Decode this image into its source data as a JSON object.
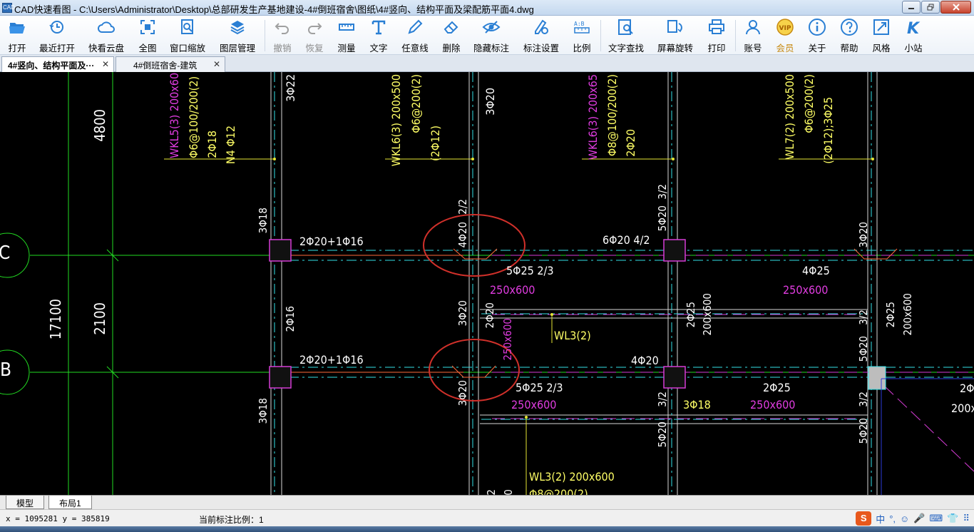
{
  "window": {
    "title": "CAD快速看图 - C:\\Users\\Administrator\\Desktop\\总部研发生产基地建设-4#倒班宿舍\\图纸\\4#竖向、结构平面及梁配筋平面4.dwg"
  },
  "toolbar": {
    "items": [
      {
        "label": "打开",
        "icon": "folder-open-icon"
      },
      {
        "label": "最近打开",
        "icon": "history-icon"
      },
      {
        "label": "快看云盘",
        "icon": "cloud-icon"
      },
      {
        "label": "全图",
        "icon": "fit-screen-icon"
      },
      {
        "label": "窗口缩放",
        "icon": "zoom-window-icon"
      },
      {
        "label": "图层管理",
        "icon": "layers-icon"
      },
      {
        "label": "撤销",
        "icon": "undo-icon"
      },
      {
        "label": "恢复",
        "icon": "redo-icon"
      },
      {
        "label": "测量",
        "icon": "ruler-icon"
      },
      {
        "label": "文字",
        "icon": "text-icon"
      },
      {
        "label": "任意线",
        "icon": "pen-icon"
      },
      {
        "label": "删除",
        "icon": "eraser-icon"
      },
      {
        "label": "隐藏标注",
        "icon": "eye-icon"
      },
      {
        "label": "标注设置",
        "icon": "annotation-settings-icon"
      },
      {
        "label": "比例",
        "icon": "scale-icon"
      },
      {
        "label": "文字查找",
        "icon": "find-text-icon"
      },
      {
        "label": "屏幕旋转",
        "icon": "rotate-icon"
      },
      {
        "label": "打印",
        "icon": "printer-icon"
      },
      {
        "label": "账号",
        "icon": "user-icon"
      },
      {
        "label": "会员",
        "icon": "vip-icon"
      },
      {
        "label": "关于",
        "icon": "info-icon"
      },
      {
        "label": "帮助",
        "icon": "help-icon"
      },
      {
        "label": "风格",
        "icon": "style-icon"
      },
      {
        "label": "小站",
        "icon": "k-site-icon"
      }
    ]
  },
  "tabs": [
    {
      "label": "4#竖向、结构平面及···",
      "active": true
    },
    {
      "label": "4#倒班宿舍-建筑",
      "active": false
    }
  ],
  "drawing": {
    "texts": {
      "wkl5": "WKL5(3) 200x60",
      "wkl5_a": "Φ6@100/200(2)",
      "wkl5_b": "2Φ18",
      "wkl5_c": "N4 Φ12",
      "wkl6a": "WKL6(3) 200x500",
      "wkl6a_a": "Φ6@200(2)",
      "wkl6a_b": "(2Φ12)",
      "wkl6b": "WKL6(3) 200x65",
      "wkl6b_a": "Φ8@100/200(2)",
      "wkl6b_b": "2Φ20",
      "wl7": "WL7(2) 200x500",
      "wl7_a": "Φ6@200(2)",
      "wl7_b": "(2Φ12);3Φ25",
      "dim_4800": "4800",
      "dim_17100": "17100",
      "dim_2100": "2100",
      "v_3p22": "3Φ22",
      "v_3p20_top": "3Φ20",
      "v_3p18_a": "3Φ18",
      "v_2p2": "2/2",
      "v_3p2_a": "3/2",
      "v_5p20_a": "5Φ20",
      "v_3p20_b": "3Φ20",
      "v_4p20": "4Φ20",
      "h_2p20_1p16_a": "2Φ20+1Φ16",
      "h_6p20": "6Φ20 4/2",
      "h_5p25_a": "5Φ25 2/3",
      "h_4p25": "4Φ25",
      "h_250x600_a": "250x600",
      "h_250x600_b": "250x600",
      "v_3p20_c": "3Φ20",
      "v_2p20": "2Φ20",
      "v_2p16": "2Φ16",
      "v_250x600": "250x600",
      "v_2p25_a": "2Φ25",
      "v_200x600_a": "200x600",
      "v_3p2_b": "3/2",
      "v_2p25_b": "2Φ25",
      "v_200x600_b": "200x600",
      "wl3": "WL3(2)",
      "h_2p20_1p16_b": "2Φ20+1Φ16",
      "h_4p20": "4Φ20",
      "v_5p20_b": "5Φ20",
      "h_5p25_b": "5Φ25 2/3",
      "h_2p25": "2Φ25",
      "h_250x600_c": "250x600",
      "h_250x600_d": "250x600",
      "h_3p18": "3Φ18",
      "v_3p18_b": "3Φ18",
      "v_3p20_d": "3Φ20",
      "v_3p2_c": "3/2",
      "v_5p20_c": "5Φ20",
      "v_3p2_d": "3/2",
      "v_5p20_d": "5Φ20",
      "v_3p2_e": "3/2",
      "v_5p20_e": "5Φ20",
      "right_2p": "2Φ",
      "right_200x": "200x",
      "wl3_bottom": "WL3(2) 200x600",
      "wl3_bottom_b": "Φ8@200(2)",
      "axis_c": "C",
      "axis_b": "B"
    }
  },
  "layout_tabs": [
    {
      "label": "模型",
      "active": true
    },
    {
      "label": "布局1",
      "active": false
    }
  ],
  "status": {
    "coords": "x = 1095281  y = 385819",
    "scale": "当前标注比例：1"
  },
  "ime": {
    "logo": "S",
    "items": [
      "中",
      "°,",
      "☺",
      "🎤",
      "⌨",
      "👕",
      "⠿"
    ]
  }
}
